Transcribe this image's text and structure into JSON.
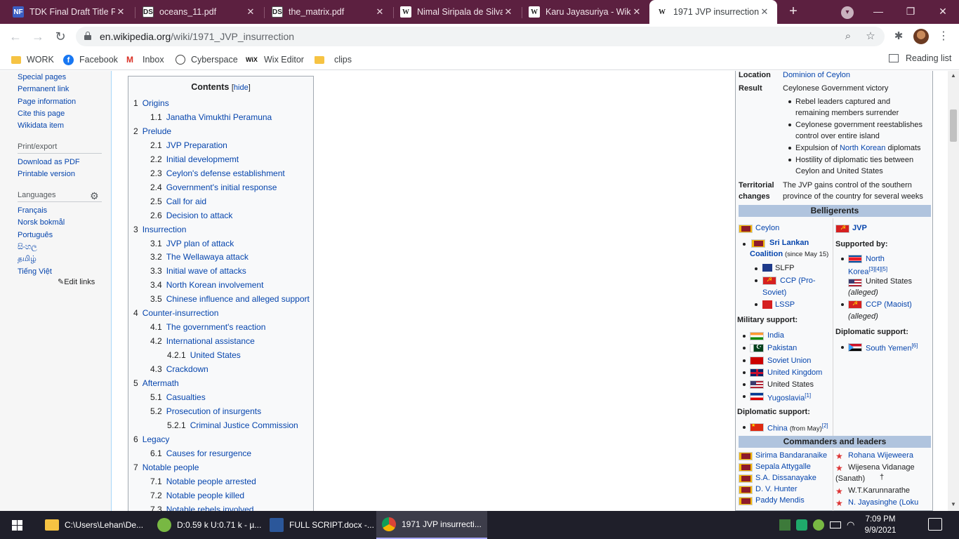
{
  "browser": {
    "tabs": [
      {
        "title": "TDK Final Draft Title Pa",
        "icon": "nf-icon",
        "mark": "NF"
      },
      {
        "title": "oceans_11.pdf",
        "icon": "ds-icon",
        "mark": "DS"
      },
      {
        "title": "the_matrix.pdf",
        "icon": "ds-icon",
        "mark": "DS"
      },
      {
        "title": "Nimal Siripala de Silva",
        "icon": "wikipedia-icon",
        "mark": "W"
      },
      {
        "title": "Karu Jayasuriya - Wikip",
        "icon": "wikipedia-icon",
        "mark": "W"
      },
      {
        "title": "1971 JVP insurrection",
        "icon": "wikipedia-icon",
        "mark": "W"
      }
    ],
    "close_glyph": "✕",
    "new_tab_glyph": "+",
    "url_host": "en.wikipedia.org",
    "url_path": "/wiki/1971_JVP_insurrection",
    "bookmarks": [
      "WORK",
      "Facebook",
      "Inbox",
      "Cyberspace",
      "Wix Editor",
      "clips"
    ],
    "bookmark_marks": {
      "facebook": "f",
      "gmail": "M",
      "wix": "WiX"
    },
    "reading_list": "Reading list"
  },
  "sidebar": {
    "links_top": [
      "Special pages",
      "Permanent link",
      "Page information",
      "Cite this page",
      "Wikidata item"
    ],
    "print_heading": "Print/export",
    "print_links": [
      "Download as PDF",
      "Printable version"
    ],
    "languages_heading": "Languages",
    "languages": [
      "Français",
      "Norsk bokmål",
      "Português",
      "සිංහල",
      "தமிழ்",
      "Tiếng Việt"
    ],
    "edit_links": "Edit links"
  },
  "toc": {
    "title": "Contents",
    "hide": "hide",
    "items": [
      {
        "num": "1",
        "text": "Origins",
        "level": 1
      },
      {
        "num": "1.1",
        "text": "Janatha Vimukthi Peramuna",
        "level": 2
      },
      {
        "num": "2",
        "text": "Prelude",
        "level": 1
      },
      {
        "num": "2.1",
        "text": "JVP Preparation",
        "level": 2
      },
      {
        "num": "2.2",
        "text": "Initial developmemt",
        "level": 2
      },
      {
        "num": "2.3",
        "text": "Ceylon's defense establishment",
        "level": 2
      },
      {
        "num": "2.4",
        "text": "Government's initial response",
        "level": 2
      },
      {
        "num": "2.5",
        "text": "Call for aid",
        "level": 2
      },
      {
        "num": "2.6",
        "text": "Decision to attack",
        "level": 2
      },
      {
        "num": "3",
        "text": "Insurrection",
        "level": 1
      },
      {
        "num": "3.1",
        "text": "JVP plan of attack",
        "level": 2
      },
      {
        "num": "3.2",
        "text": "The Wellawaya attack",
        "level": 2
      },
      {
        "num": "3.3",
        "text": "Initial wave of attacks",
        "level": 2
      },
      {
        "num": "3.4",
        "text": "North Korean involvement",
        "level": 2
      },
      {
        "num": "3.5",
        "text": "Chinese influence and alleged support",
        "level": 2
      },
      {
        "num": "4",
        "text": "Counter-insurrection",
        "level": 1
      },
      {
        "num": "4.1",
        "text": "The government's reaction",
        "level": 2
      },
      {
        "num": "4.2",
        "text": "International assistance",
        "level": 2
      },
      {
        "num": "4.2.1",
        "text": "United States",
        "level": 3
      },
      {
        "num": "4.3",
        "text": "Crackdown",
        "level": 2
      },
      {
        "num": "5",
        "text": "Aftermath",
        "level": 1
      },
      {
        "num": "5.1",
        "text": "Casualties",
        "level": 2
      },
      {
        "num": "5.2",
        "text": "Prosecution of insurgents",
        "level": 2
      },
      {
        "num": "5.2.1",
        "text": "Criminal Justice Commission",
        "level": 3
      },
      {
        "num": "6",
        "text": "Legacy",
        "level": 1
      },
      {
        "num": "6.1",
        "text": "Causes for resurgence",
        "level": 2
      },
      {
        "num": "7",
        "text": "Notable people",
        "level": 1
      },
      {
        "num": "7.1",
        "text": "Notable people arrested",
        "level": 2
      },
      {
        "num": "7.2",
        "text": "Notable people killed",
        "level": 2
      },
      {
        "num": "7.3",
        "text": "Notable rebels involved",
        "level": 2
      }
    ]
  },
  "infobox": {
    "location_label": "Location",
    "location_value": "Dominion of Ceylon",
    "result_label": "Result",
    "result_value": "Ceylonese Government victory",
    "result_bullets": [
      [
        "Rebel leaders captured and",
        "remaining members surrender"
      ],
      [
        "Ceylonese government reestablishes",
        "control over entire island"
      ],
      [
        "Expulsion of ",
        "North Korean",
        " diplomats"
      ],
      [
        "Hostility of diplomatic ties between",
        "Ceylon and United States"
      ]
    ],
    "territorial_label": [
      "Territorial",
      "changes"
    ],
    "territorial_value": [
      "The JVP gains control of the southern",
      "province of the country for several weeks"
    ],
    "belligerents_header": "Belligerents",
    "left": {
      "ceylon": "Ceylon",
      "coalition": [
        "Sri Lankan",
        "Coalition"
      ],
      "coalition_note": "(since May 15)",
      "slfp": "SLFP",
      "ccp_pro": [
        "CCP (Pro-",
        "Soviet)"
      ],
      "lssp": "LSSP",
      "military_support_label": "Military support:",
      "military": [
        "India",
        "Pakistan",
        "Soviet Union",
        "United Kingdom",
        "United States",
        "Yugoslavia"
      ],
      "yugoslavia_ref": "[1]",
      "diplomatic_support_label": "Diplomatic support:",
      "china": "China",
      "china_note": "(from May)",
      "china_ref": "[2]"
    },
    "right": {
      "jvp": "JVP",
      "supported_by_label": "Supported by:",
      "north_korea": [
        "North",
        "Korea"
      ],
      "north_korea_refs": "[3][4][5]",
      "us": "United States",
      "alleged": "(alleged)",
      "ccp_maoist": "CCP (Maoist)",
      "diplomatic_support_label": "Diplomatic support:",
      "south_yemen": "South Yemen",
      "south_yemen_ref": "[6]"
    },
    "commanders_header": "Commanders and leaders",
    "commanders_left": [
      "Sirima Bandaranaike",
      "Sepala Attygalle",
      "S.A. Dissanayake",
      "D. V. Hunter",
      "Paddy Mendis"
    ],
    "commanders_right": [
      "Rohana Wijeweera",
      "Wijesena Vidanage",
      "(Sanath)",
      "W.T.Karunnarathe",
      "N. Jayasinghe (Loku"
    ],
    "dagger": "†"
  },
  "taskbar": {
    "items": [
      {
        "label": "C:\\Users\\Lehan\\De...",
        "icon": "folder-icon"
      },
      {
        "label": "D:0.59 k U:0.71 k - µ...",
        "icon": "utorrent-icon"
      },
      {
        "label": "FULL SCRIPT.docx -...",
        "icon": "word-icon"
      },
      {
        "label": "1971 JVP insurrecti...",
        "icon": "chrome-icon"
      }
    ],
    "time": "7:09 PM",
    "date": "9/9/2021"
  },
  "colors": {
    "tabstrip": "#5c2040",
    "link": "#0645ad",
    "infobox_header": "#b0c4de",
    "taskbar": "#1f1f2a"
  }
}
